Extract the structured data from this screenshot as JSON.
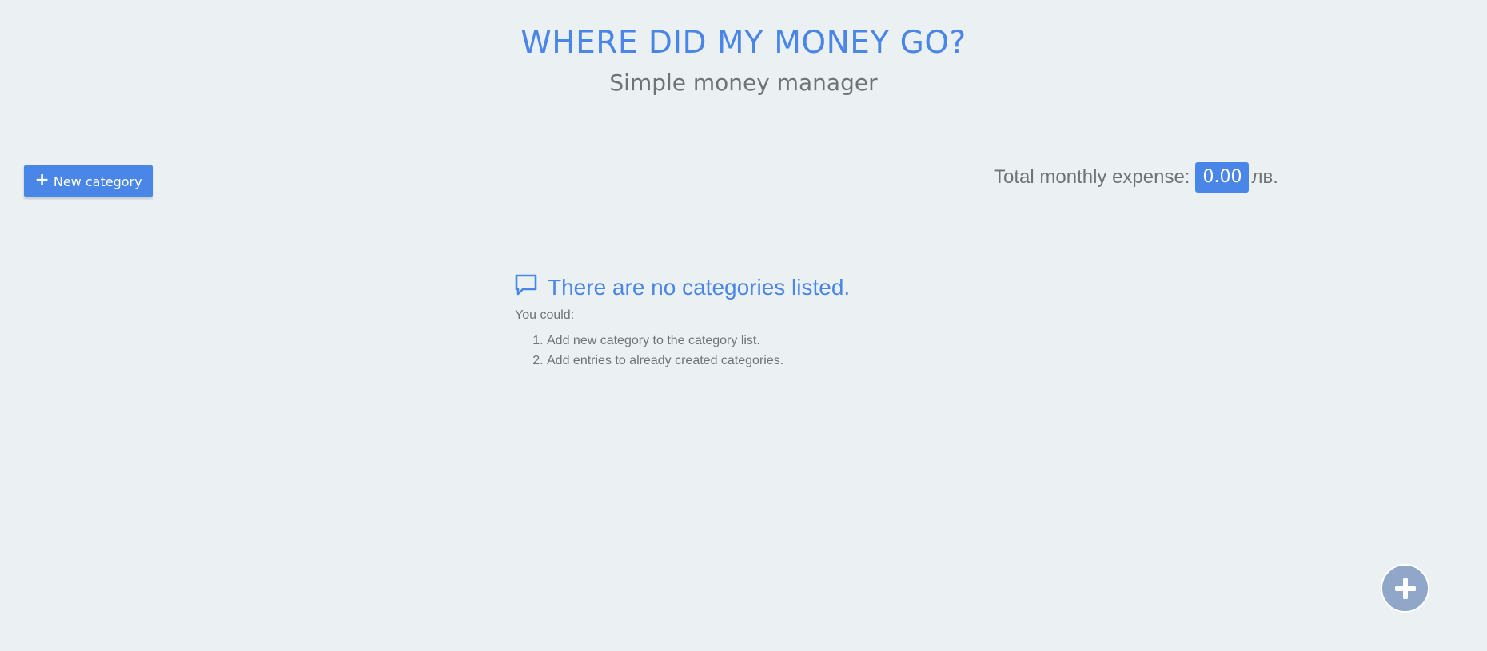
{
  "header": {
    "title": "WHERE DID MY MONEY GO?",
    "subtitle": "Simple money manager"
  },
  "toolbar": {
    "new_category_label": "New category",
    "new_category_icon": "plus-icon"
  },
  "total": {
    "label": "Total monthly expense:",
    "amount": "0.00",
    "currency": "лв."
  },
  "empty_state": {
    "icon": "comment-icon",
    "title": "There are no categories listed.",
    "intro": "You could:",
    "suggestions": [
      "Add new category to the category list.",
      "Add entries to already created categories."
    ]
  },
  "fab": {
    "icon": "plus-icon"
  },
  "colors": {
    "background": "#ebf0f2",
    "accent": "#4a86e8",
    "text": "#6e7378",
    "fab": "#91a7c9"
  }
}
